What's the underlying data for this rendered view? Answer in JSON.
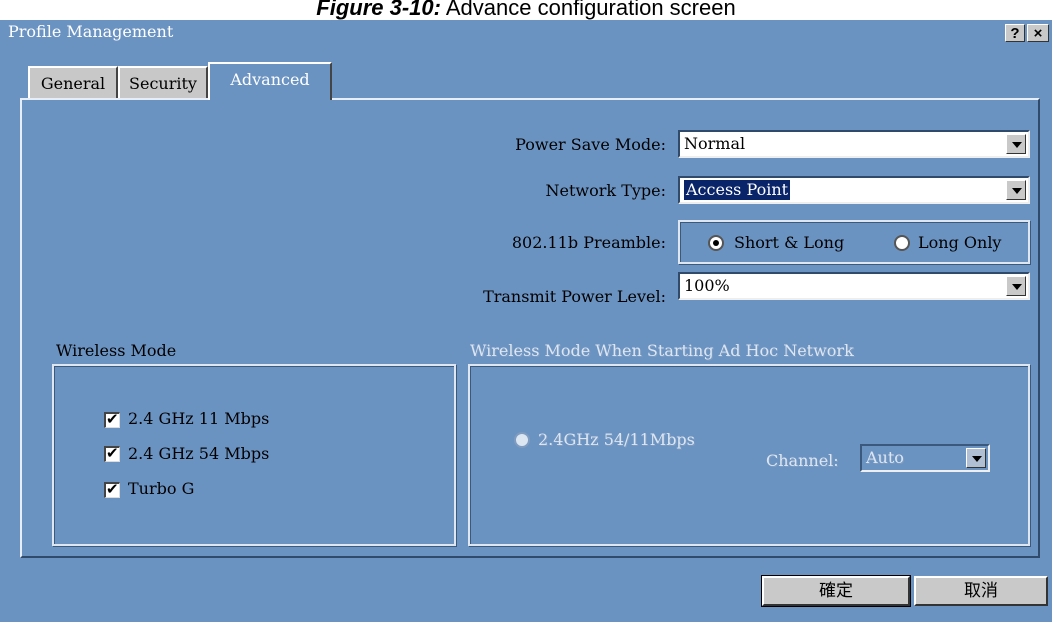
{
  "caption": {
    "bold": "Figure 3-10:",
    "rest": " Advance configuration screen"
  },
  "window": {
    "title": "Profile Management",
    "help_glyph": "?",
    "close_glyph": "×"
  },
  "tabs": [
    {
      "label": "General"
    },
    {
      "label": "Security"
    },
    {
      "label": "Advanced",
      "active": true
    }
  ],
  "fields": {
    "power_save": {
      "label": "Power Save Mode:",
      "value": "Normal"
    },
    "network_type": {
      "label": "Network Type:",
      "value": "Access Point"
    },
    "preamble": {
      "label": "802.11b Preamble:",
      "option_short_long": "Short & Long",
      "option_long_only": "Long Only",
      "selected": "Short & Long"
    },
    "transmit_power": {
      "label": "Transmit Power Level:",
      "value": "100%"
    }
  },
  "wireless_mode": {
    "title": "Wireless Mode",
    "options": [
      {
        "label": "2.4 GHz 11 Mbps",
        "checked": true
      },
      {
        "label": "2.4 GHz 54 Mbps",
        "checked": true
      },
      {
        "label": "Turbo G",
        "checked": true
      }
    ]
  },
  "adhoc": {
    "title": "Wireless Mode When Starting Ad Hoc Network",
    "option": "2.4GHz 54/11Mbps",
    "channel_label": "Channel:",
    "channel_value": "Auto"
  },
  "buttons": {
    "ok": "確定",
    "cancel": "取消"
  },
  "colors": {
    "dialog_bg": "#6b93c2",
    "selection": "#0a246a",
    "button_face": "#c9c9c9"
  }
}
